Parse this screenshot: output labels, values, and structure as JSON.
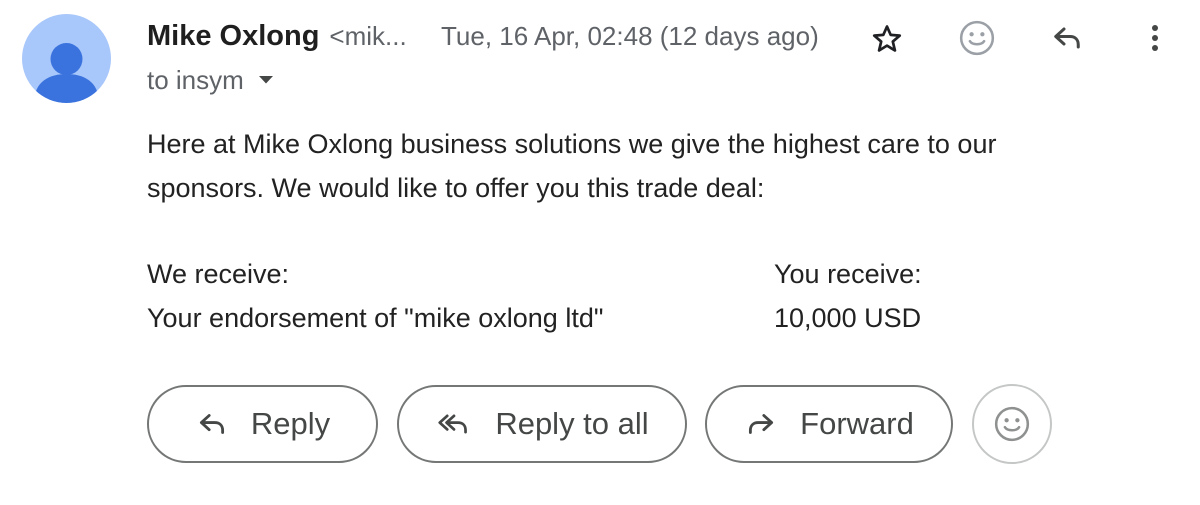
{
  "header": {
    "sender_name": "Mike Oxlong",
    "sender_email": "<mik...",
    "date": "Tue, 16 Apr, 02:48 (12 days ago)",
    "recipient": "to insym"
  },
  "icons": {
    "avatar": "person-icon",
    "star": "star-icon",
    "emoji": "smiley-icon",
    "reply": "reply-icon",
    "more": "more-vert-icon",
    "caret": "caret-down-icon",
    "reply_all": "reply-all-icon",
    "forward": "forward-icon"
  },
  "message": {
    "paragraph": "Here at Mike Oxlong business solutions we give the highest care to our sponsors. We would like to offer you this trade deal:",
    "deal": {
      "left_heading": "We receive:",
      "left_value": "Your endorsement of \"mike oxlong ltd\"",
      "right_heading": "You receive:",
      "right_value": "10,000 USD"
    }
  },
  "actions": {
    "reply": "Reply",
    "reply_all": "Reply to all",
    "forward": "Forward"
  },
  "colors": {
    "avatar_bg": "#a8c7fa",
    "avatar_fg": "#3b73de",
    "text": "#202124",
    "muted": "#5f6368"
  }
}
